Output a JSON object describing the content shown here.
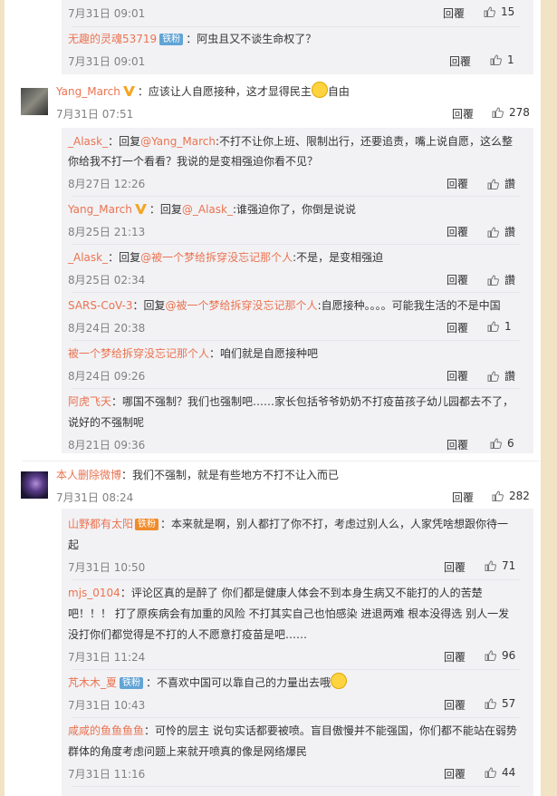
{
  "thread_top": {
    "row0": {
      "time": "7月31日 09:01",
      "reply": "回覆",
      "likes": "15"
    },
    "row1": {
      "user": "无趣的灵魂53719",
      "badge": "铁粉",
      "text": "：阿虫且又不谈生命权了？",
      "time": "7月31日 09:01",
      "reply": "回覆",
      "likes": "1"
    }
  },
  "comment1": {
    "user": "Yang_March",
    "text_pre": "：应该让人自愿接种，这才显得民主",
    "text_post": "自由",
    "time": "7月31日 07:51",
    "reply": "回覆",
    "likes": "278",
    "replies": [
      {
        "user": "_Alask_",
        "sep": "：回复",
        "target": "@Yang_March",
        "text": ":不打不让你上班、限制出行，还要追责，嘴上说自愿，这么整",
        "text2": "你给我不打一个看看？我说的是变相强迫你看不见？",
        "time": "8月27日 12:26",
        "reply": "回覆",
        "likes": "讚"
      },
      {
        "user": "Yang_March",
        "sep": "：回复",
        "target": "@_Alask_",
        "text": ":谁强迫你了，你倒是说说",
        "time": "8月25日 21:13",
        "reply": "回覆",
        "likes": "讚"
      },
      {
        "user": "_Alask_",
        "sep": "：回复",
        "target": "@被一个梦给拆穿没忘记那个人",
        "text": ":不是，是变相强迫",
        "time": "8月25日 02:34",
        "reply": "回覆",
        "likes": "讚"
      },
      {
        "user": "SARS-CoV-3",
        "sep": "：回复",
        "target": "@被一个梦给拆穿没忘记那个人",
        "text": ":自愿接种。。。。可能我生活的不是中国",
        "time": "8月24日 20:38",
        "reply": "回覆",
        "likes": "1"
      },
      {
        "user": "被一个梦给拆穿没忘记那个人",
        "text": "：咱们就是自愿接种吧",
        "time": "8月24日 09:26",
        "reply": "回覆",
        "likes": "讚"
      },
      {
        "user": "阿虎飞天",
        "text": "：哪国不强制？我们也强制吧……家长包括爷爷奶奶不打疫苗孩子幼儿园都去不了，",
        "text2": "说好的不强制呢",
        "time": "8月21日 09:36",
        "reply": "回覆",
        "likes": "6"
      }
    ]
  },
  "comment2": {
    "user": "本人删除微博",
    "text": "：我们不强制，就是有些地方不打不让入而已",
    "time": "7月31日 08:24",
    "reply": "回覆",
    "likes": "282",
    "replies": [
      {
        "user": "山野都有太阳",
        "badge": "铁粉",
        "text": "：本来就是啊，别人都打了你不打，考虑过别人么，人家凭啥想跟你待一",
        "text2": "起",
        "time": "7月31日 10:50",
        "reply": "回覆",
        "likes": "71"
      },
      {
        "user": "mjs_0104",
        "text": "：评论区真的是醉了 你们都是健康人体会不到本身生病又不能打的人的苦楚",
        "text2": "吧！！！ 打了原疾病会有加重的风险 不打其实自己也怕感染 进退两难 根本没得选   别人一发",
        "text3": "没打你们都觉得是不打的人不愿意打疫苗是吧……",
        "time": "7月31日 11:24",
        "reply": "回覆",
        "likes": "96"
      },
      {
        "user": "芃木木_夏",
        "badge": "铁粉",
        "text": "：不喜欢中国可以靠自己的力量出去哦",
        "time": "7月31日 10:43",
        "reply": "回覆",
        "likes": "57"
      },
      {
        "user": "咸咸的鱼鱼鱼鱼",
        "text": "：可怜的层主 说句实话都要被喷。盲目傲慢并不能强国，你们都不能站在弱势",
        "text2": "群体的角度考虑问题上来就开喷真的像是网络爆民",
        "time": "7月31日 11:16",
        "reply": "回覆",
        "likes": "44"
      }
    ]
  },
  "colors": {
    "background": "#f1e3c4",
    "link": "#eb7350",
    "subpanel": "#f2f2f5",
    "badge": "#62a4d6"
  }
}
